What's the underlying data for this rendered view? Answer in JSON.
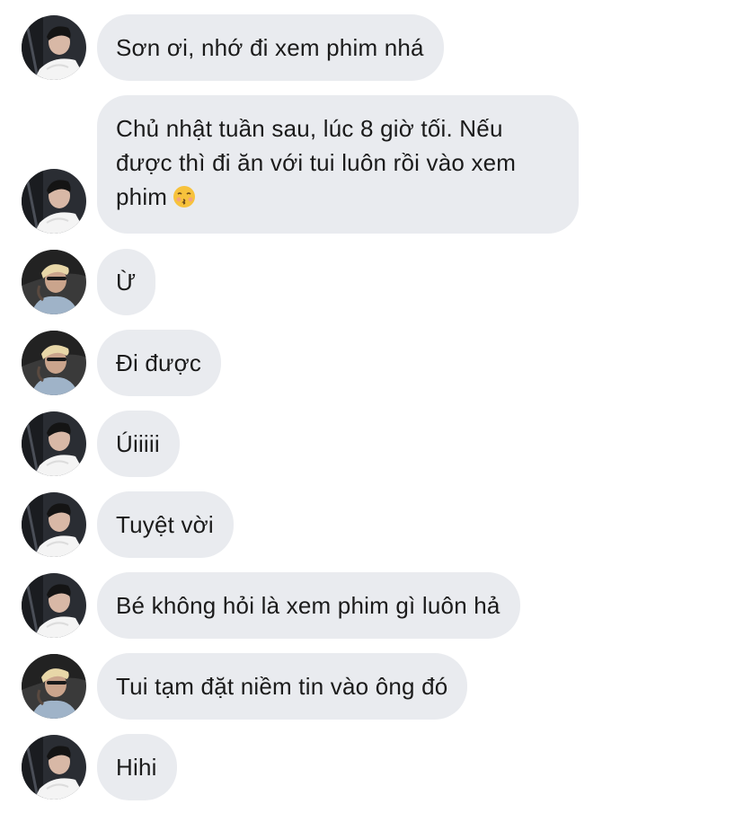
{
  "messages": [
    {
      "sender": "a",
      "text": "Sơn ơi, nhớ đi xem phim nhá"
    },
    {
      "sender": "a",
      "text": "Chủ nhật tuần sau, lúc 8 giờ tối. Nếu được thì đi ăn với tui luôn rồi vào xem phim",
      "emoji": "kissing-face-emoji"
    },
    {
      "sender": "b",
      "text": "Ừ"
    },
    {
      "sender": "b",
      "text": "Đi được"
    },
    {
      "sender": "a",
      "text": "Úiiiii"
    },
    {
      "sender": "a",
      "text": "Tuyệt vời"
    },
    {
      "sender": "a",
      "text": "Bé không hỏi là xem phim gì luôn hả"
    },
    {
      "sender": "b",
      "text": "Tui tạm đặt niềm tin vào ông đó"
    },
    {
      "sender": "a",
      "text": "Hihi"
    }
  ],
  "colors": {
    "bubble": "#e9ebef",
    "text": "#1b1b1b",
    "background": "#ffffff"
  }
}
